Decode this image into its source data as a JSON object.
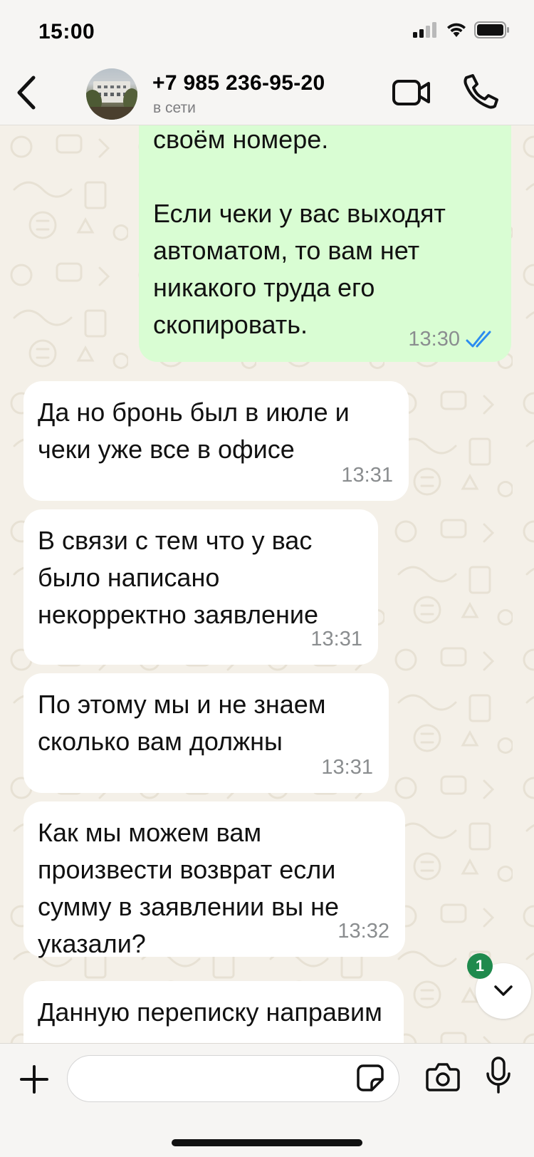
{
  "status_bar": {
    "time": "15:00"
  },
  "header": {
    "contact_name": "+7 985 236-95-20",
    "contact_status": "в сети"
  },
  "messages": [
    {
      "direction": "out",
      "text": "своём номере.\n\nЕсли чеки у вас выходят автоматом, то вам нет никакого труда его скопировать.",
      "time": "13:30",
      "read": true
    },
    {
      "direction": "in",
      "text": "Да но бронь был в июле и чеки уже все в офисе",
      "time": "13:31"
    },
    {
      "direction": "in",
      "text": "В связи с тем что у вас было написано некорректно заявление",
      "time": "13:31"
    },
    {
      "direction": "in",
      "text": "По этому мы и не знаем сколько вам должны",
      "time": "13:31"
    },
    {
      "direction": "in",
      "text": "Как мы можем вам произвести возврат если сумму в заявлении вы не указали?",
      "time": "13:32"
    },
    {
      "direction": "in",
      "text": "Данную переписку направим в поддержку",
      "time": ""
    }
  ],
  "scroll_button": {
    "unread_count": "1"
  },
  "composer": {
    "input_value": ""
  },
  "colors": {
    "outgoing_bubble": "#d9fdd3",
    "incoming_bubble": "#ffffff",
    "read_ticks": "#2b8cf0",
    "unread_badge": "#1f8a4d"
  },
  "icons": {
    "back": "chevron-left-icon",
    "video": "video-camera-icon",
    "call": "phone-icon",
    "scroll": "chevron-down-icon",
    "plus": "plus-icon",
    "sticker": "sticker-icon",
    "camera": "camera-icon",
    "mic": "microphone-icon"
  }
}
